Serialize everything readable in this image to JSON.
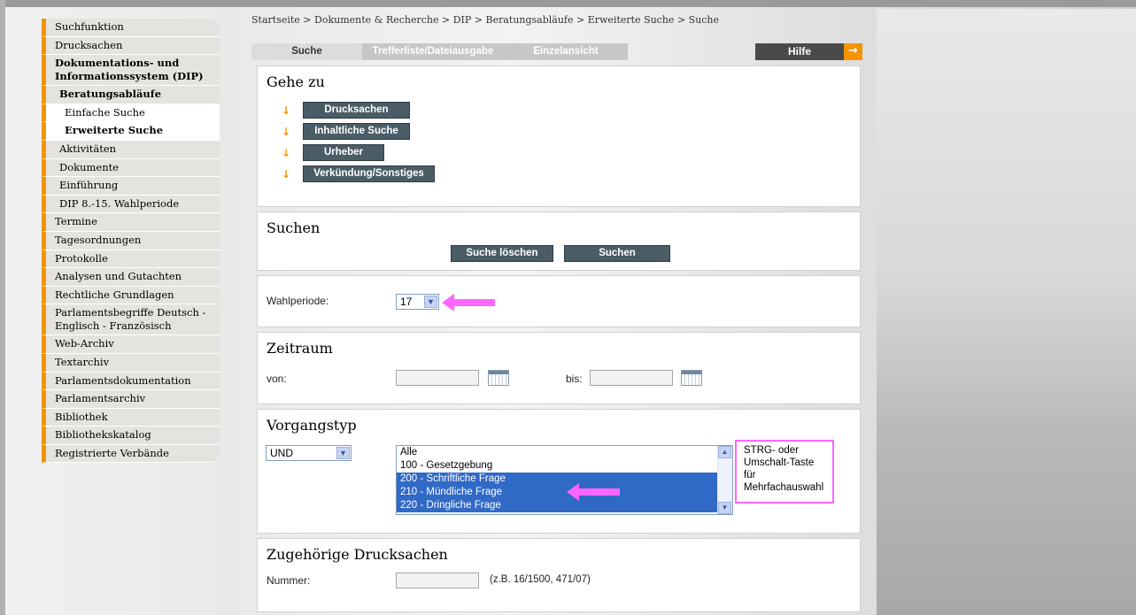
{
  "sidebar": {
    "items": [
      {
        "label": "Suchfunktion"
      },
      {
        "label": "Drucksachen"
      },
      {
        "label": "Dokumentations- und Informationssystem (DIP)"
      },
      {
        "label": "Beratungsabläufe"
      },
      {
        "label": "Einfache Suche"
      },
      {
        "label": "Erweiterte Suche"
      },
      {
        "label": "Aktivitäten"
      },
      {
        "label": "Dokumente"
      },
      {
        "label": "Einführung"
      },
      {
        "label": "DIP 8.-15. Wahlperiode"
      },
      {
        "label": "Termine"
      },
      {
        "label": "Tagesordnungen"
      },
      {
        "label": "Protokolle"
      },
      {
        "label": "Analysen und Gutachten"
      },
      {
        "label": "Rechtliche Grundlagen"
      },
      {
        "label": "Parlamentsbegriffe Deutsch - Englisch - Französisch"
      },
      {
        "label": "Web-Archiv"
      },
      {
        "label": "Textarchiv"
      },
      {
        "label": "Parlamentsdokumentation"
      },
      {
        "label": "Parlamentsarchiv"
      },
      {
        "label": "Bibliothek"
      },
      {
        "label": "Bibliothekskatalog"
      },
      {
        "label": "Registrierte Verbände"
      }
    ]
  },
  "breadcrumb": "Startseite > Dokumente & Recherche > DIP > Beratungsabläufe > Erweiterte Suche > Suche",
  "tabs": {
    "suche": "Suche",
    "treffer": "Trefferliste/Dateiausgabe",
    "einzel": "Einzelansicht"
  },
  "help": {
    "label": "Hilfe",
    "arrow": "→"
  },
  "gehe_zu": {
    "title": "Gehe zu",
    "arrow": "↓",
    "links": [
      "Drucksachen",
      "Inhaltliche Suche",
      "Urheber",
      "Verkündung/Sonstiges"
    ]
  },
  "suchen": {
    "title": "Suchen",
    "clear_label": "Suche löschen",
    "search_label": "Suchen"
  },
  "wahlperiode": {
    "label": "Wahlperiode:",
    "value": "17"
  },
  "zeitraum": {
    "title": "Zeitraum",
    "von_label": "von:",
    "bis_label": "bis:"
  },
  "vorgangstyp": {
    "title": "Vorgangstyp",
    "operator": "UND",
    "options": [
      "Alle",
      "100 - Gesetzgebung",
      "200 - Schriftliche Frage",
      "210 - Mündliche Frage",
      "220 - Dringliche Frage"
    ],
    "hint": "STRG- oder Umschalt-Taste für Mehrfachauswahl"
  },
  "drucksachen": {
    "title": "Zugehörige Drucksachen",
    "nummer_label": "Nummer:",
    "example": "(z.B. 16/1500, 471/07)"
  },
  "colors": {
    "accent": "#f39400",
    "button": "#4a5c66",
    "highlight": "#ff66ff",
    "selection": "#3169c6"
  }
}
